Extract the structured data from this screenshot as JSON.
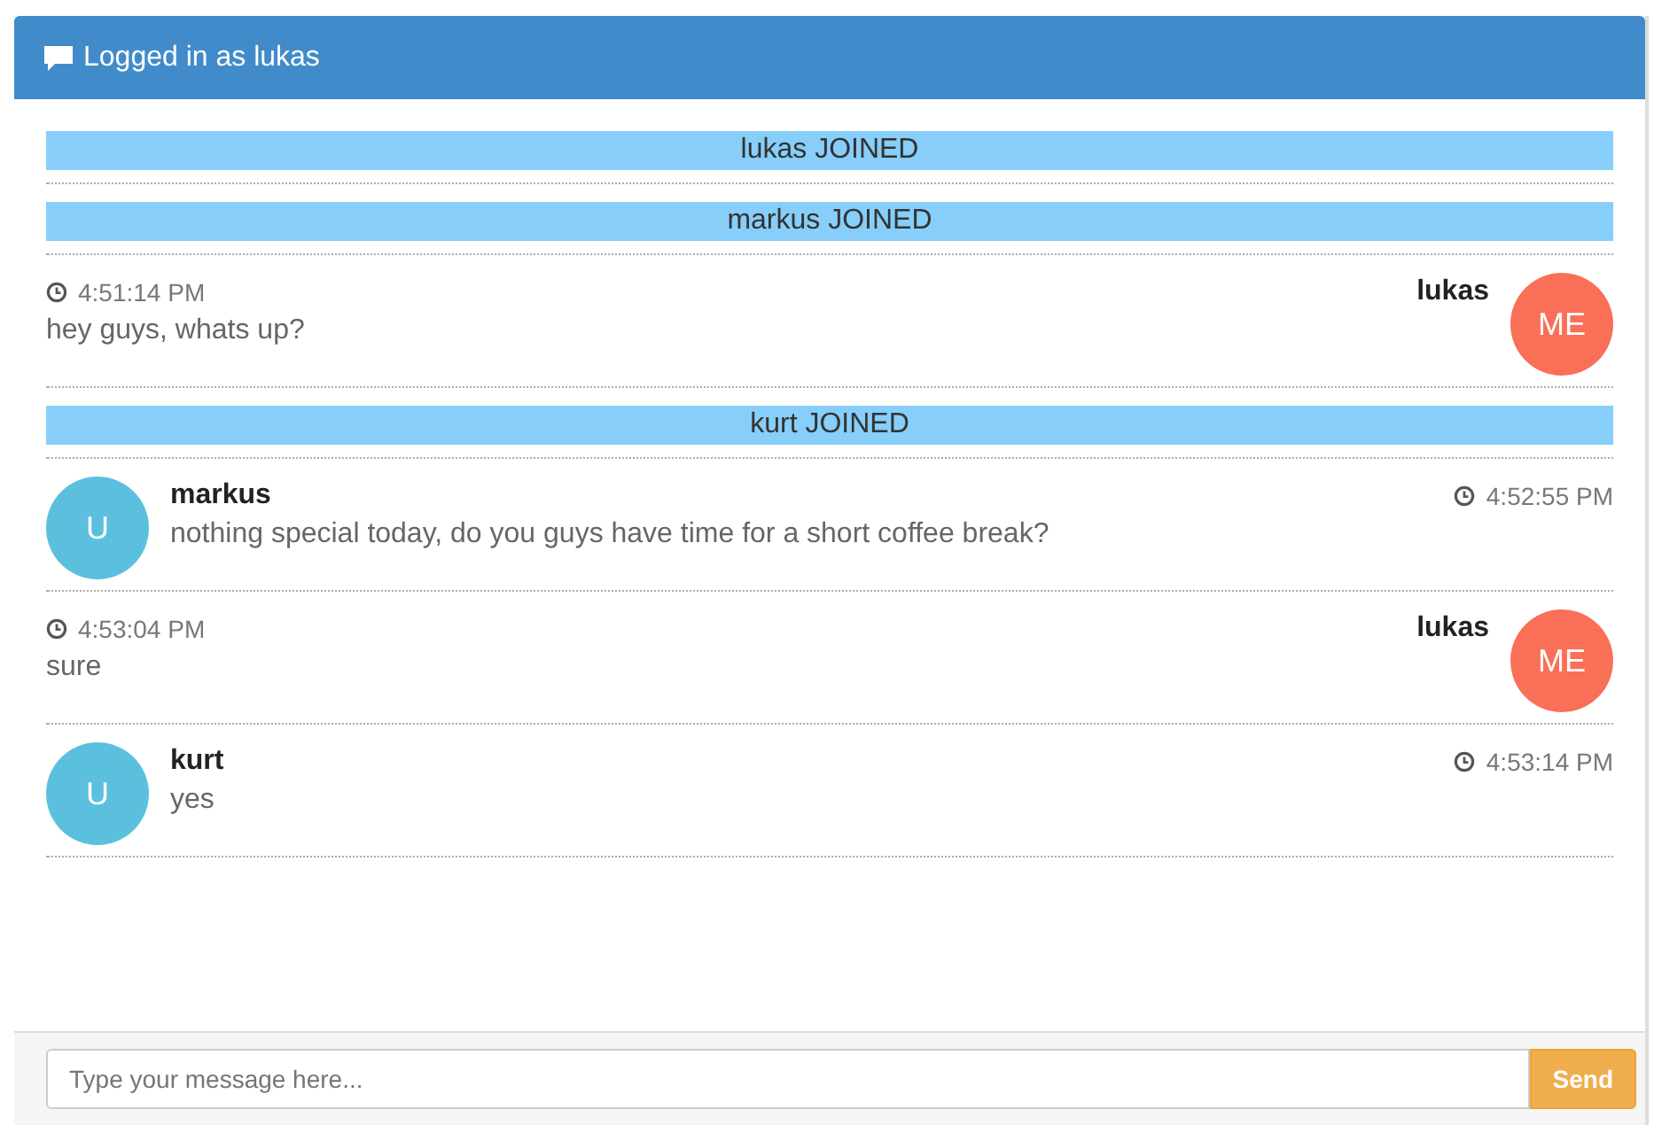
{
  "header": {
    "title": "Logged in as lukas"
  },
  "entries": [
    {
      "kind": "event",
      "text": "lukas JOINED"
    },
    {
      "kind": "event",
      "text": "markus JOINED"
    },
    {
      "kind": "message",
      "mine": true,
      "user": "lukas",
      "avatar": "ME",
      "time": "4:51:14 PM",
      "text": "hey guys, whats up?"
    },
    {
      "kind": "event",
      "text": "kurt JOINED"
    },
    {
      "kind": "message",
      "mine": false,
      "user": "markus",
      "avatar": "U",
      "time": "4:52:55 PM",
      "text": "nothing special today, do you guys have time for a short coffee break?"
    },
    {
      "kind": "message",
      "mine": true,
      "user": "lukas",
      "avatar": "ME",
      "time": "4:53:04 PM",
      "text": "sure"
    },
    {
      "kind": "message",
      "mine": false,
      "user": "kurt",
      "avatar": "U",
      "time": "4:53:14 PM",
      "text": "yes"
    }
  ],
  "composer": {
    "placeholder": "Type your message here...",
    "button": "Send"
  }
}
